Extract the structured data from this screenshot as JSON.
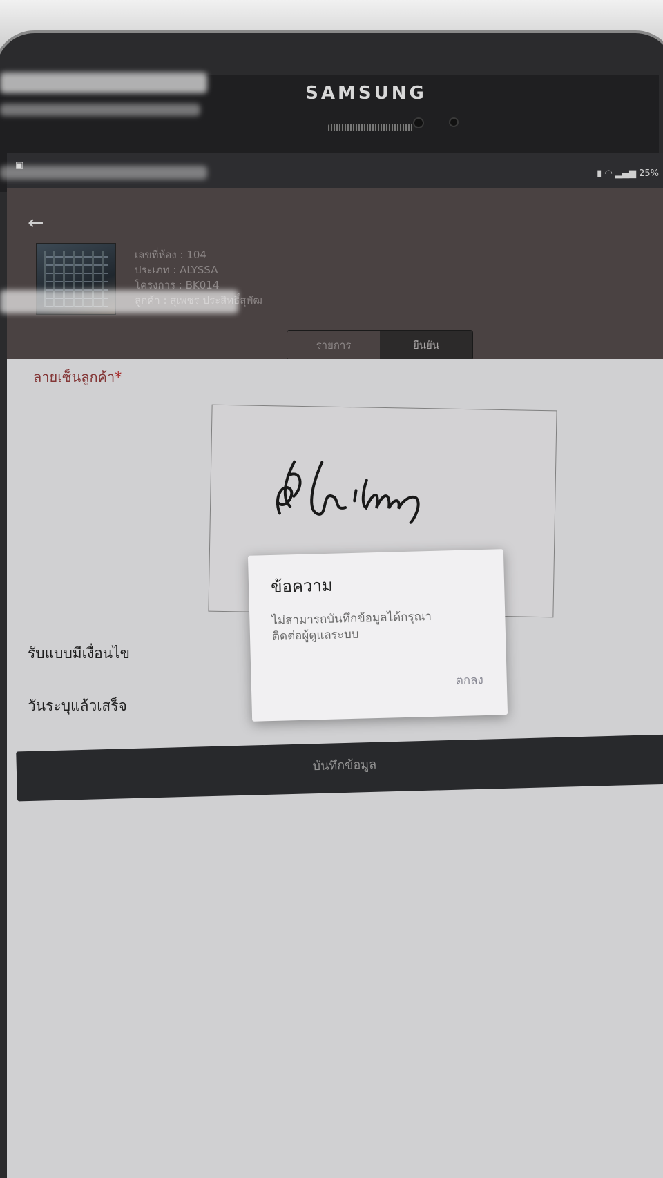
{
  "device": {
    "brand": "SAMSUNG"
  },
  "statusbar": {
    "indicators": "25%"
  },
  "unit": {
    "room": "เลขที่ห้อง : 104",
    "type": "ประเภท : ALYSSA",
    "project": "โครงการ : BK014",
    "customer": "ลูกค้า : สุเพชร ประสิทธิ์สุพัฒ"
  },
  "tabs": [
    {
      "label": "รายการ",
      "active": false
    },
    {
      "label": "ยืนยัน",
      "active": true
    }
  ],
  "signature": {
    "label": "ลายเซ็นลูกค้า",
    "required_mark": "*"
  },
  "options": {
    "conditional": "รับแบบมีเงื่อนไข",
    "completed": "วันระบุแล้วเสร็จ"
  },
  "save_button": {
    "label": "บันทึกข้อมูล"
  },
  "dialog": {
    "title": "ข้อความ",
    "message_line1": "ไม่สามารถบันทึกข้อมูลได้กรุณา",
    "message_line2": "ติดต่อผู้ดูแลระบบ",
    "ok_label": "ตกลง"
  },
  "colors": {
    "required": "#b02222",
    "toolbar": "#2b2c2f",
    "appbar": "#4a4242"
  }
}
